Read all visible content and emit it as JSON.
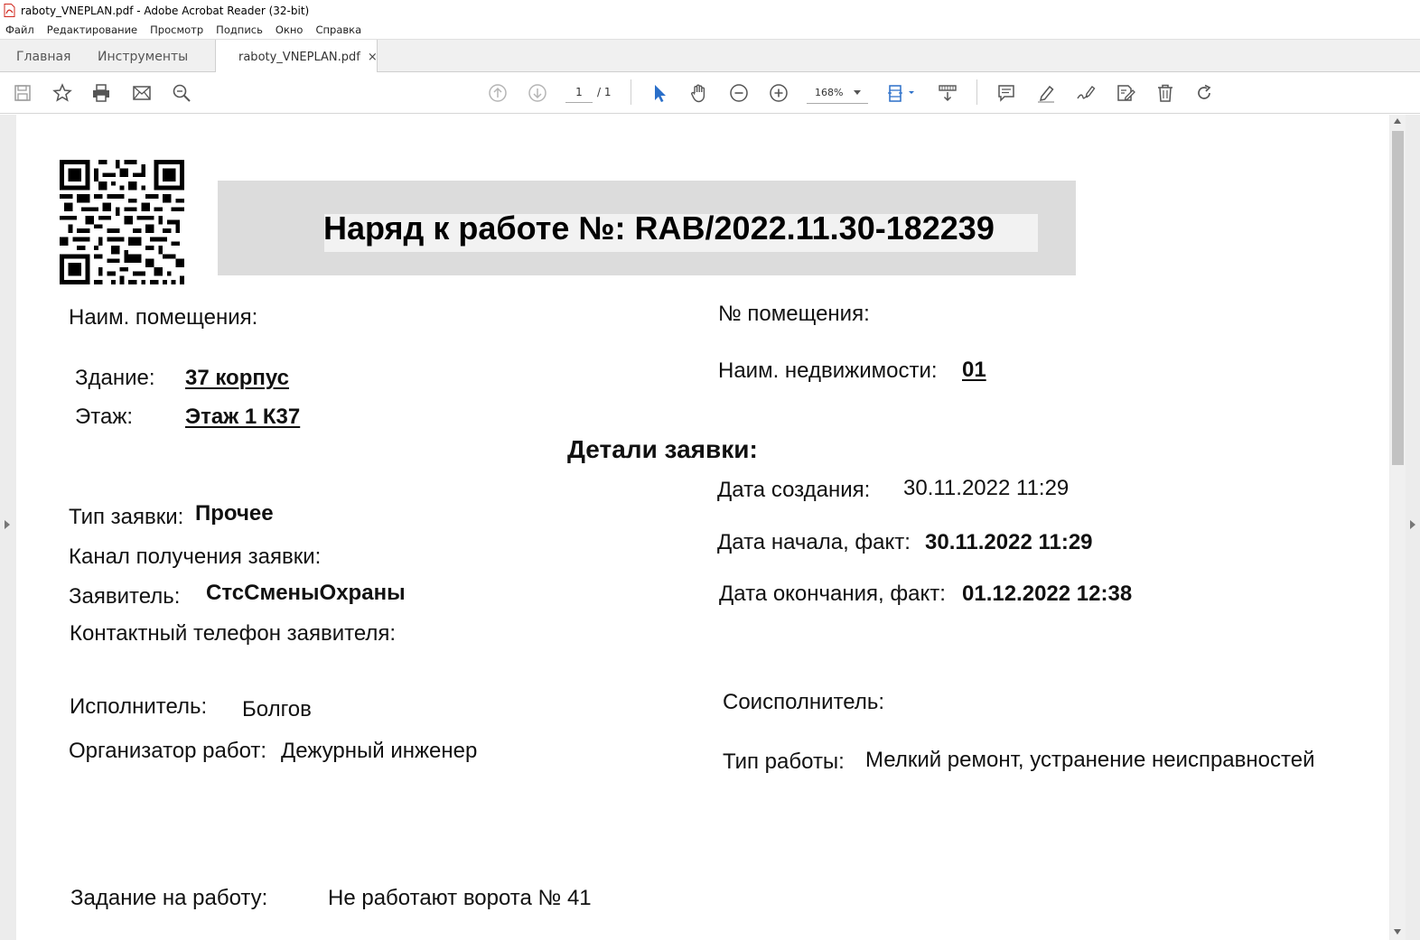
{
  "window": {
    "title": "raboty_VNEPLAN.pdf - Adobe Acrobat Reader (32-bit)"
  },
  "menu": [
    "Файл",
    "Редактирование",
    "Просмотр",
    "Подпись",
    "Окно",
    "Справка"
  ],
  "tabs": {
    "home": "Главная",
    "tools": "Инструменты",
    "document": "raboty_VNEPLAN.pdf",
    "close_glyph": "×"
  },
  "toolbar": {
    "page_current": "1",
    "page_total": "/ 1",
    "zoom": "168%",
    "icons": [
      "save-icon",
      "bookmark-star-icon",
      "print-icon",
      "email-icon",
      "find-zoom-icon",
      "page-up-icon",
      "page-down-icon",
      "select-cursor-icon",
      "hand-icon",
      "zoom-out-icon",
      "zoom-in-icon",
      "fit-page-icon",
      "scroll-mode-icon",
      "comment-icon",
      "highlight-icon",
      "sign-icon",
      "fill-sign-icon",
      "delete-icon",
      "rotate-icon"
    ]
  },
  "document": {
    "title": "Наряд к работе №: RAB/2022.11.30-182239",
    "room_name_label": "Наим. помещения:",
    "room_number_label": "№ помещения:",
    "building_label": "Здание:",
    "building_value": "37 корпус",
    "floor_label": "Этаж:",
    "floor_value": "Этаж 1 К37",
    "property_label": "Наим. недвижимости:",
    "property_value": "01",
    "details_heading": "Детали заявки:",
    "created_label": "Дата создания:",
    "created_value": "30.11.2022 11:29",
    "request_type_label": "Тип заявки:",
    "request_type_value": "Прочее",
    "start_label": "Дата начала, факт:",
    "start_value": "30.11.2022 11:29",
    "channel_label": "Канал получения заявки:",
    "applicant_label": "Заявитель:",
    "applicant_value": "СтсСменыОхраны",
    "end_label": "Дата окончания, факт:",
    "end_value": "01.12.2022 12:38",
    "phone_label": "Контактный телефон заявителя:",
    "executor_label": "Исполнитель:",
    "executor_value": "Болгов",
    "coexecutor_label": "Соисполнитель:",
    "organizer_label": "Организатор работ:",
    "organizer_value": "Дежурный инженер",
    "work_type_label": "Тип работы:",
    "work_type_value": "Мелкий ремонт, устранение неисправностей",
    "task_label": "Задание на работу:",
    "task_value": "Не работают ворота № 41"
  },
  "colors": {
    "accent_blue": "#2a6fc9",
    "title_band": "#dcdcdc",
    "acrobat_red": "#d0271d"
  }
}
